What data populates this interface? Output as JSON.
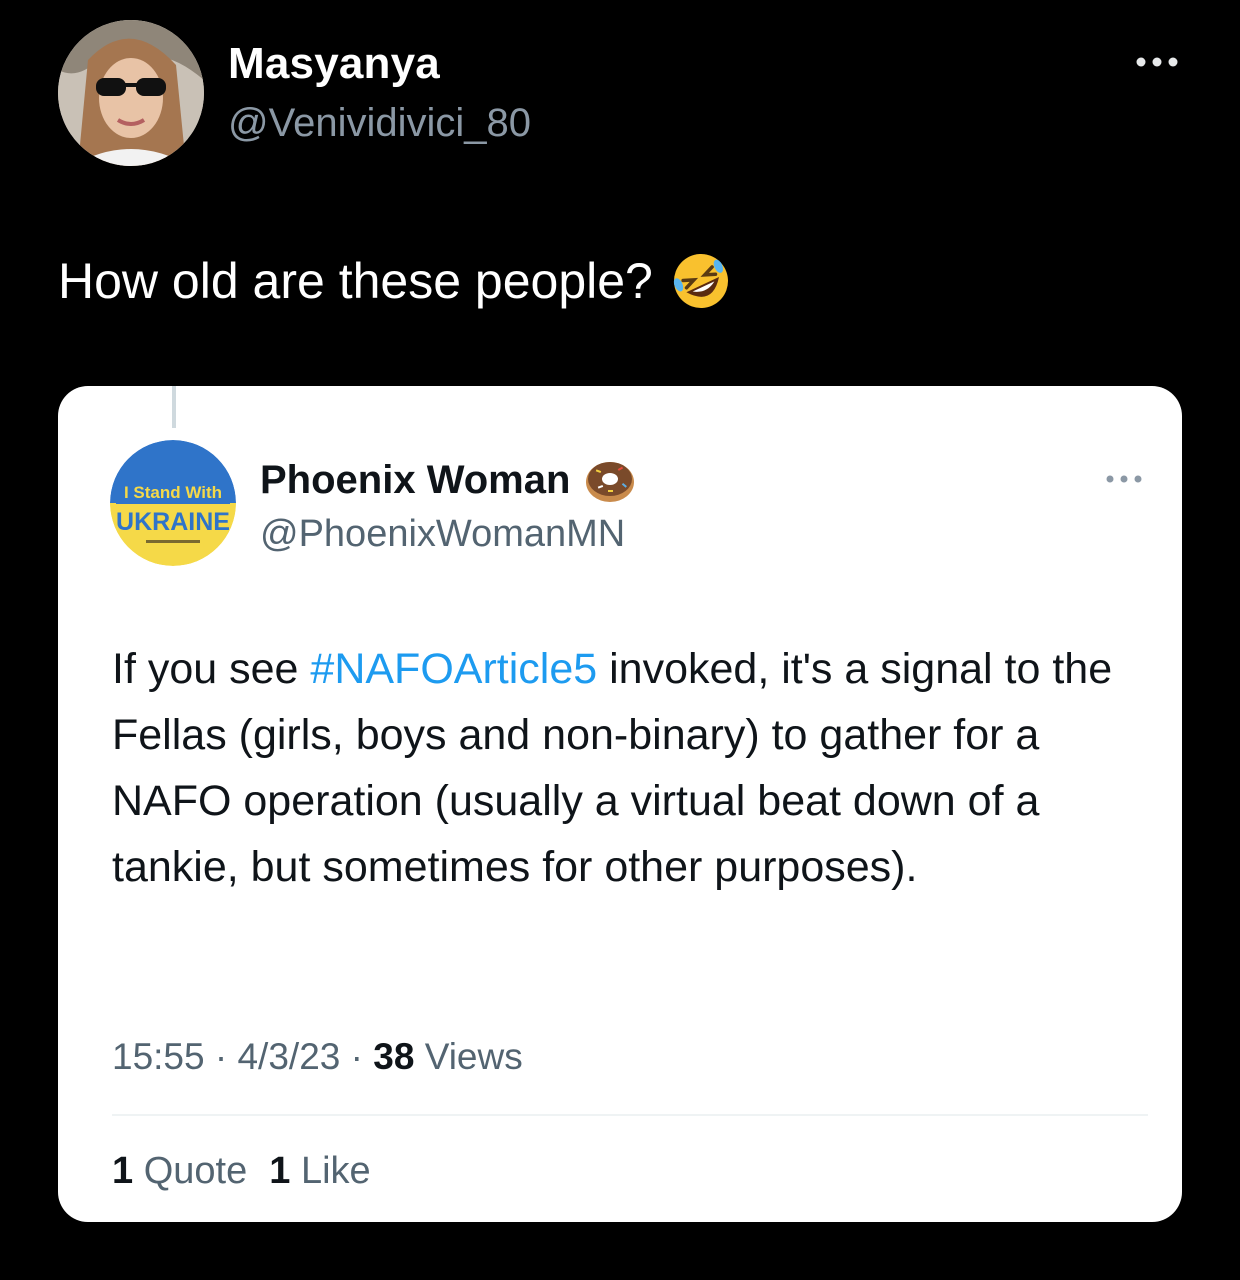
{
  "tweet": {
    "author": {
      "name": "Masyanya",
      "handle": "@Venividivici_80",
      "avatar_icon": "profile-photo-woman-sunglasses"
    },
    "text": "How old are these people?",
    "emoji_icon": "rolling-on-floor-laughing-emoji",
    "more_icon": "more-options-icon"
  },
  "quoted": {
    "author": {
      "name": "Phoenix Woman",
      "name_emoji_icon": "donut-emoji",
      "handle": "@PhoenixWomanMN",
      "avatar_badge_line1": "I Stand With",
      "avatar_badge_line2": "UKRAINE",
      "avatar_colors": {
        "top": "#2f74c9",
        "bottom": "#f5d948"
      }
    },
    "body_prefix": "If you see ",
    "hashtag": "#NAFOArticle5",
    "body_suffix": " invoked, it's a signal to the Fellas (girls, boys and non-binary) to gather for a NAFO operation (usually a virtual beat down of a tankie, but sometimes for other purposes).",
    "meta": {
      "time": "15:55",
      "separator": "·",
      "date": "4/3/23",
      "views_count": "38",
      "views_label": "Views"
    },
    "stats": {
      "quotes_count": "1",
      "quotes_label": "Quote",
      "likes_count": "1",
      "likes_label": "Like"
    }
  },
  "colors": {
    "background": "#000000",
    "card": "#ffffff",
    "secondary_dark": "#8b98a5",
    "secondary_light": "#536471",
    "link": "#1d9bf0"
  }
}
